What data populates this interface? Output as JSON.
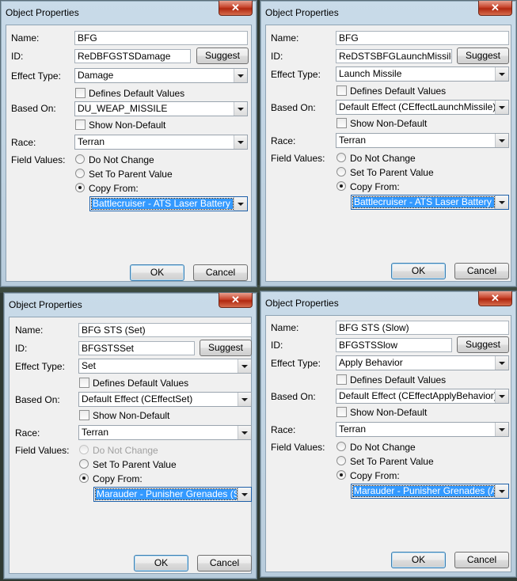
{
  "window_title": "Object Properties",
  "close_glyph": "✕",
  "labels": {
    "name": "Name:",
    "id": "ID:",
    "effect_type": "Effect Type:",
    "defines_default": "Defines Default Values",
    "based_on": "Based On:",
    "show_non_default": "Show Non-Default",
    "race": "Race:",
    "field_values": "Field Values:",
    "do_not_change": "Do Not Change",
    "set_to_parent": "Set To Parent Value",
    "copy_from": "Copy From:",
    "suggest": "Suggest",
    "ok": "OK",
    "cancel": "Cancel"
  },
  "dialogs": [
    {
      "name": "BFG",
      "id": "ReDBFGSTSDamage",
      "effect_type": "Damage",
      "based_on": "DU_WEAP_MISSILE",
      "race": "Terran",
      "copy_from": "Battlecruiser - ATS Laser Battery (Damage)",
      "do_not_change_disabled": false
    },
    {
      "name": "BFG",
      "id": "ReDSTSBFGLaunchMissile",
      "effect_type": "Launch Missile",
      "based_on": "Default Effect (CEffectLaunchMissile)",
      "race": "Terran",
      "copy_from": "Battlecruiser - ATS Laser Battery (Launch Missile)",
      "do_not_change_disabled": false
    },
    {
      "name": "BFG STS (Set)",
      "id": "BFGSTSSet",
      "effect_type": "Set",
      "based_on": "Default Effect (CEffectSet)",
      "race": "Terran",
      "copy_from": "Marauder - Punisher Grenades (Set)",
      "do_not_change_disabled": true
    },
    {
      "name": "BFG STS (Slow)",
      "id": "BFGSTSSlow",
      "effect_type": "Apply Behavior",
      "based_on": "Default Effect (CEffectApplyBehavior)",
      "race": "Terran",
      "copy_from": "Marauder - Punisher Grenades (Apply Behavior)",
      "do_not_change_disabled": false
    }
  ]
}
